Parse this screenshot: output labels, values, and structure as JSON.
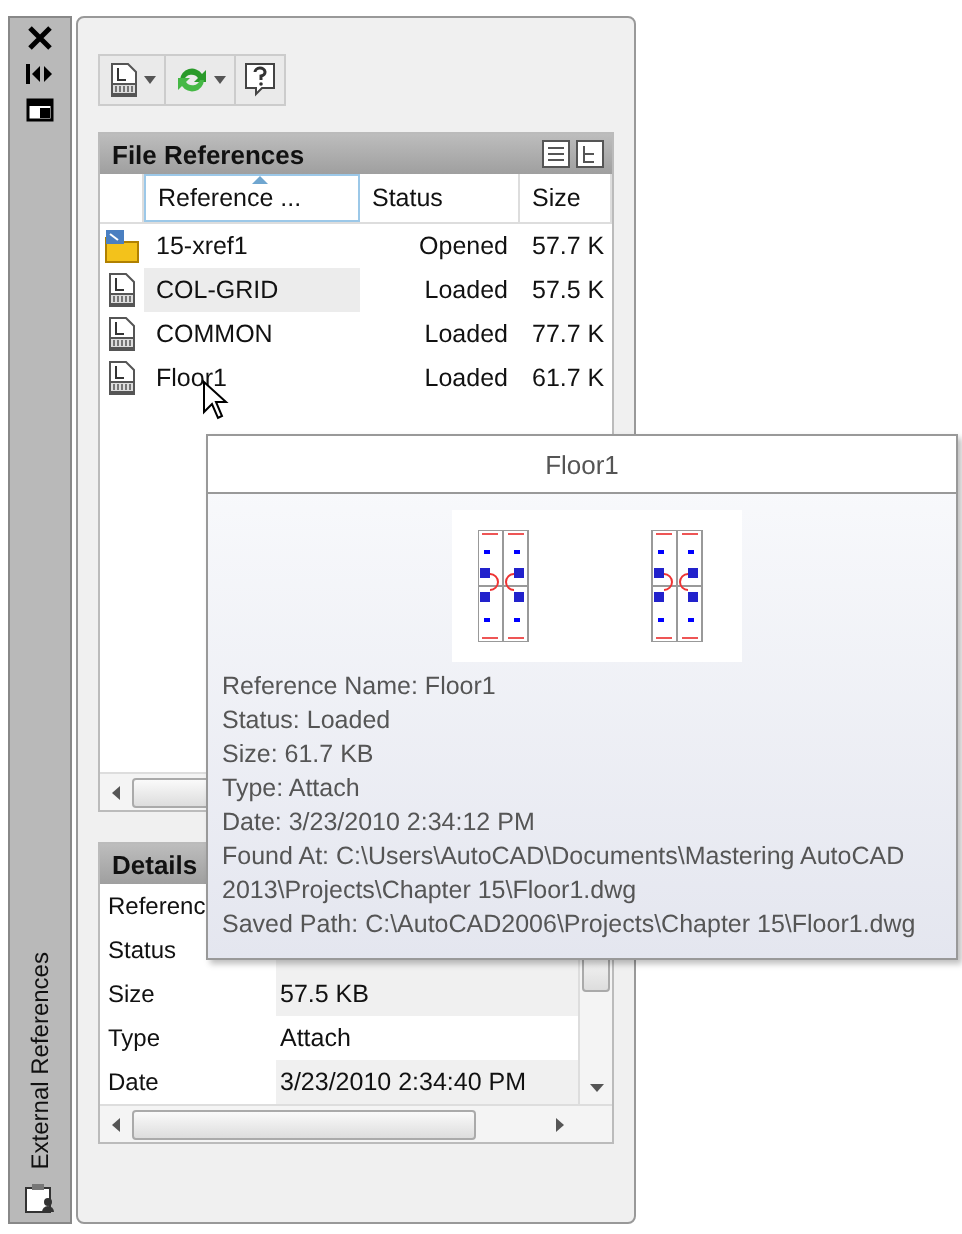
{
  "side_strip": {
    "title": "External References"
  },
  "file_references": {
    "title": "File References",
    "columns": [
      {
        "label": "Reference ...",
        "sorted": true
      },
      {
        "label": "Status",
        "sorted": false
      },
      {
        "label": "Size",
        "sorted": false
      }
    ],
    "rows": [
      {
        "kind": "current",
        "name": "15-xref1",
        "status": "Opened",
        "size": "57.7 K",
        "selected": false
      },
      {
        "kind": "dwg",
        "name": "COL-GRID",
        "status": "Loaded",
        "size": "57.5 K",
        "selected": true
      },
      {
        "kind": "dwg",
        "name": "COMMON",
        "status": "Loaded",
        "size": "77.7 K",
        "selected": false
      },
      {
        "kind": "dwg",
        "name": "Floor1",
        "status": "Loaded",
        "size": "61.7 K",
        "selected": false
      }
    ]
  },
  "details": {
    "title": "Details",
    "rows": [
      {
        "label": "Referenc"
      },
      {
        "label": "Status"
      },
      {
        "label": "Size",
        "value": "57.5 KB",
        "selected": false
      },
      {
        "label": "Type",
        "value": "Attach",
        "selected": true
      },
      {
        "label": "Date",
        "value": "3/23/2010 2:34:40 PM",
        "selected": false
      }
    ]
  },
  "tooltip": {
    "title": "Floor1",
    "lines": [
      "Reference Name: Floor1",
      "Status: Loaded",
      "Size: 61.7 KB",
      "Type: Attach",
      "Date: 3/23/2010 2:34:12 PM",
      "Found At: C:\\Users\\AutoCAD\\Documents\\Mastering AutoCAD",
      "2013\\Projects\\Chapter 15\\Floor1.dwg",
      "Saved Path: C:\\AutoCAD2006\\Projects\\Chapter 15\\Floor1.dwg"
    ]
  }
}
